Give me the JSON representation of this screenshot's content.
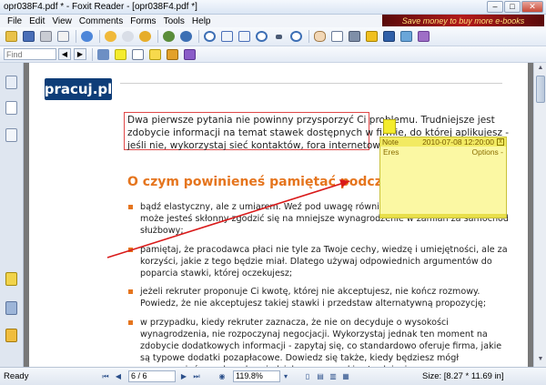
{
  "window": {
    "title": "opr038F4.pdf * - Foxit Reader - [opr038F4.pdf *]",
    "minimize": "–",
    "maximize": "□",
    "close": "✕"
  },
  "menu": [
    "File",
    "Edit",
    "View",
    "Comments",
    "Forms",
    "Tools",
    "Help"
  ],
  "ad_banner": "Save money to buy more e-books",
  "find": {
    "placeholder": "Find",
    "prev": "◀",
    "next": "▶"
  },
  "document": {
    "logo": "pracuj.pl",
    "intro": "Dwa pierwsze pytania nie powinny przysporzyć Ci problemu. Trudniejsze jest zdobycie informacji na temat stawek dostępnych w firmie, do której aplikujesz - jeśli nie, wykorzystaj sieć kontaktów, fora internetowe, opinie w internecie.",
    "heading": "O czym powinieneś pamiętać podczas negocjacji?",
    "bullets": [
      "bądź elastyczny, ale z umiarem. Weź pod uwagę również dodatki pozapłacowe. Być może jesteś skłonny zgodzić się na mniejsze wynagrodzenie w zamian za samochód służbowy;",
      "pamiętaj, że pracodawca płaci nie tyle za Twoje cechy, wiedzę i umiejętności, ale za korzyści, jakie z tego będzie miał. Dlatego używaj odpowiednich argumentów do poparcia stawki, której oczekujesz;",
      "jeżeli rekruter proponuje Ci kwotę, której nie akceptujesz, nie kończ rozmowy. Powiedz, że nie akceptujesz takiej stawki i przedstaw alternatywną propozycję;",
      "w przypadku, kiedy rekruter zaznacza, że nie on decyduje o wysokości wynagrodzenia, nie rozpoczynaj negocjacji. Wykorzystaj jednak ten moment na zdobycie dodatkowych informacji - zapytaj się, co standardowo oferuje firma, jakie są typowe dodatki pozapłacowe. Dowiedz się także, kiedy będziesz mógł porozmawiać z osobą odpowiedzialną za warunki zatrudnienia."
    ]
  },
  "note": {
    "title": "Note",
    "date": "2010-07-08 12:20:00",
    "author": "Eres",
    "options": "Options -",
    "close": "x"
  },
  "status": {
    "text": "Ready",
    "page": "6 / 6",
    "zoom": "119.8%",
    "size": "Size: [8.27 * 11.69 in]"
  },
  "colors": {
    "accent": "#e5751e",
    "annotation_line": "#d91a1a",
    "note_bg": "#fbf8a3"
  }
}
